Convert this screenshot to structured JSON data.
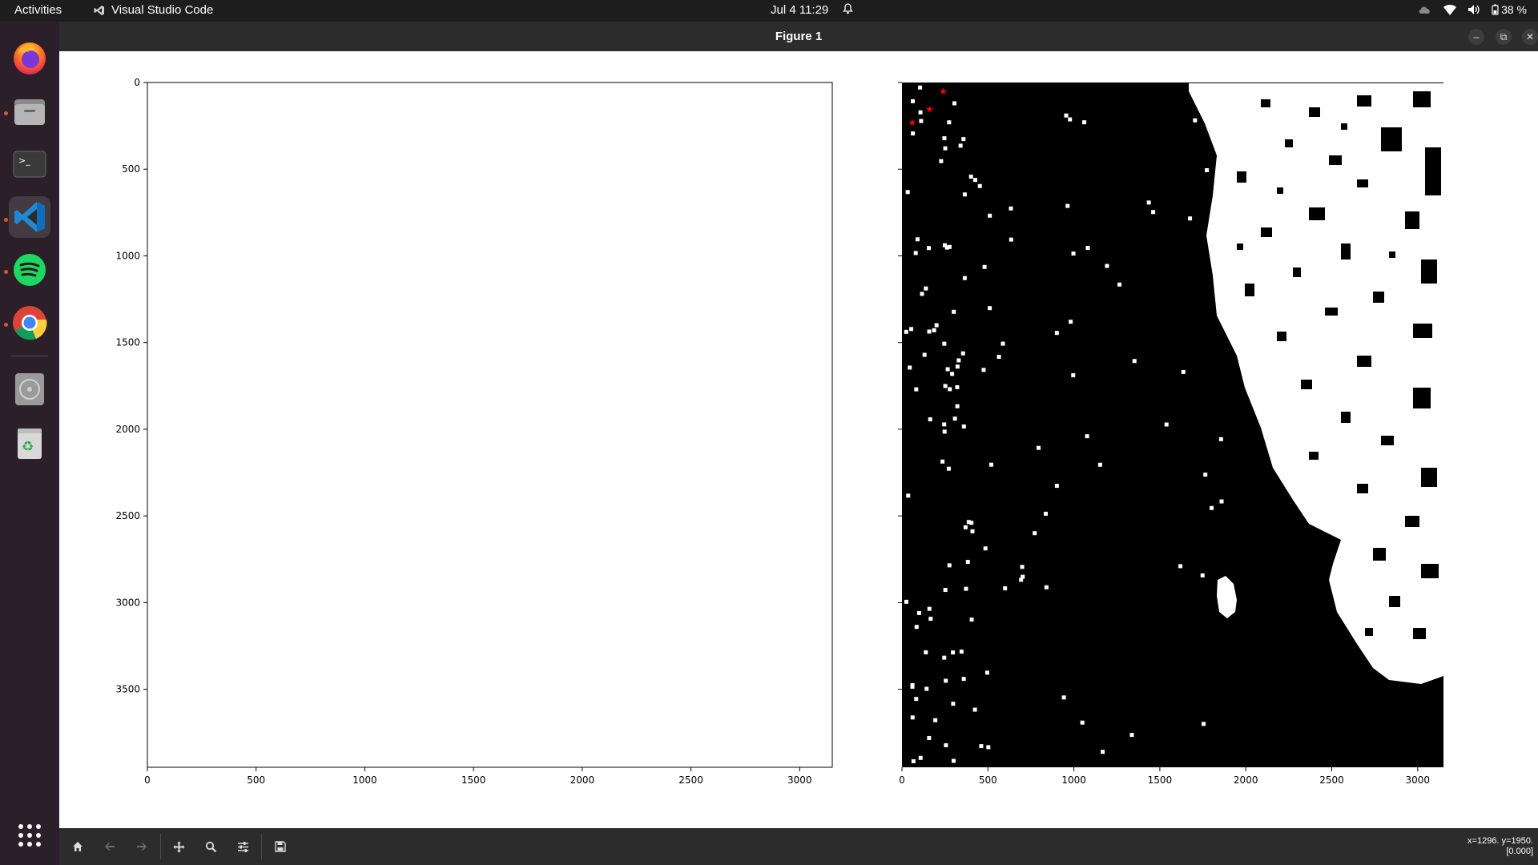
{
  "topbar": {
    "activities": "Activities",
    "app_name": "Visual Studio Code",
    "clock": "Jul 4  11:29",
    "battery": "38 %"
  },
  "dock": {
    "items": [
      {
        "name": "firefox",
        "icon": "firefox-icon",
        "running": false
      },
      {
        "name": "files",
        "icon": "files-icon",
        "running": true
      },
      {
        "name": "terminal",
        "icon": "terminal-icon",
        "running": false
      },
      {
        "name": "vscode",
        "icon": "vscode-icon",
        "running": true,
        "active": true
      },
      {
        "name": "spotify",
        "icon": "spotify-icon",
        "running": true
      },
      {
        "name": "chrome",
        "icon": "chrome-icon",
        "running": true
      },
      {
        "name": "disc",
        "icon": "disc-icon",
        "running": false
      },
      {
        "name": "trash",
        "icon": "trash-icon",
        "running": false
      }
    ],
    "apps_grid": "show-applications-icon"
  },
  "window": {
    "title": "Figure 1"
  },
  "toolbar": {
    "buttons": [
      "home-icon",
      "back-icon",
      "forward-icon",
      "pan-icon",
      "zoom-icon",
      "configure-subplots-icon",
      "save-icon"
    ],
    "coords_line1": "x=1296. y=1950.",
    "coords_line2": "[0.000]"
  },
  "chart_data": [
    {
      "type": "image",
      "content": "blank white image",
      "xlim": [
        0,
        3150
      ],
      "ylim": [
        3950,
        0
      ],
      "x_ticks": [
        "0",
        "500",
        "1000",
        "1500",
        "2000",
        "2500",
        "3000"
      ],
      "y_ticks": [
        "0",
        "500",
        "1000",
        "1500",
        "2000",
        "2500",
        "3000",
        "3500"
      ]
    },
    {
      "type": "image",
      "content": "binary black and white mask with red star markers",
      "xlim": [
        0,
        3150
      ],
      "ylim": [
        3950,
        0
      ],
      "x_ticks": [
        "0",
        "500",
        "1000",
        "1500",
        "2000",
        "2500",
        "3000"
      ],
      "markers": [
        {
          "x": 240,
          "y": 50,
          "color": "#ff0000",
          "shape": "star"
        },
        {
          "x": 160,
          "y": 155,
          "color": "#ff0000",
          "shape": "star"
        },
        {
          "x": 60,
          "y": 230,
          "color": "#ff0000",
          "shape": "star"
        }
      ]
    }
  ],
  "colors": {
    "topbar": "#1d1d1d",
    "dock": "#2b1f2a",
    "titlebar": "#2c2c2c",
    "marker": "#ff0000",
    "running_dot": "#e95420"
  }
}
